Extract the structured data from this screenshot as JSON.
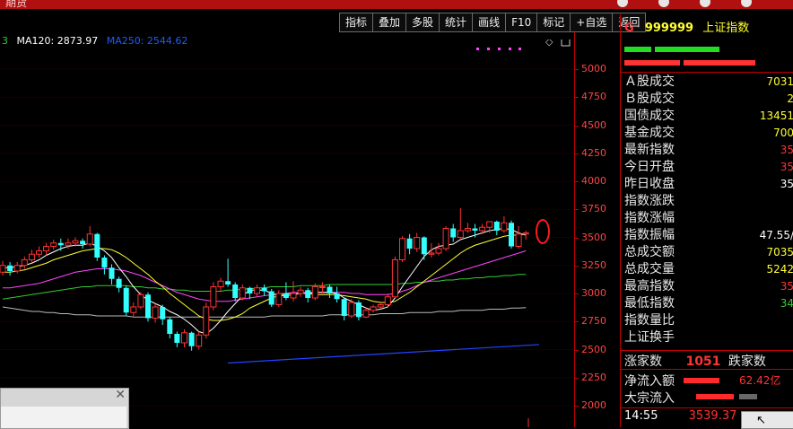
{
  "window": {
    "title": "期货"
  },
  "toolbar": {
    "buttons": [
      "指标",
      "叠加",
      "多股",
      "统计",
      "画线",
      "F10",
      "标记",
      "+自选",
      "返回"
    ]
  },
  "legend": {
    "prefix": "3",
    "ma120": "MA120: 2873.97",
    "ma250": "MA250: 2544.62",
    "ma120_color": "#ffffff",
    "ma250_color": "#1c5cff"
  },
  "axis": {
    "labels": [
      "5000",
      "4750",
      "4500",
      "4250",
      "4000",
      "3750",
      "3500",
      "3250",
      "3000",
      "2750",
      "2500",
      "2250",
      "2000"
    ]
  },
  "chart_data": {
    "type": "candlestick",
    "ylim": [
      2000,
      5000
    ],
    "colors": {
      "up": "#ff3333",
      "down": "#33ffff",
      "ma5": "#ffffff",
      "ma10": "#ffff33",
      "ma20": "#ff44ff",
      "ma60": "#33cc33",
      "ma120": "#bbbbbb",
      "ma250": "#2244ff"
    },
    "candles": [
      [
        3190,
        3250,
        3160,
        3290
      ],
      [
        3250,
        3200,
        3160,
        3280
      ],
      [
        3200,
        3250,
        3180,
        3280
      ],
      [
        3250,
        3300,
        3220,
        3330
      ],
      [
        3300,
        3350,
        3270,
        3390
      ],
      [
        3350,
        3380,
        3320,
        3420
      ],
      [
        3380,
        3420,
        3340,
        3450
      ],
      [
        3420,
        3450,
        3390,
        3480
      ],
      [
        3450,
        3430,
        3380,
        3490
      ],
      [
        3430,
        3450,
        3400,
        3490
      ],
      [
        3450,
        3470,
        3420,
        3500
      ],
      [
        3470,
        3440,
        3400,
        3490
      ],
      [
        3440,
        3530,
        3420,
        3600
      ],
      [
        3530,
        3320,
        3290,
        3540
      ],
      [
        3320,
        3230,
        3170,
        3340
      ],
      [
        3230,
        3130,
        3080,
        3260
      ],
      [
        3130,
        3050,
        3010,
        3150
      ],
      [
        3050,
        2830,
        2800,
        3070
      ],
      [
        2830,
        2880,
        2790,
        2920
      ],
      [
        2880,
        2990,
        2860,
        3010
      ],
      [
        2990,
        2780,
        2750,
        3010
      ],
      [
        2780,
        2880,
        2740,
        2910
      ],
      [
        2880,
        2770,
        2720,
        2900
      ],
      [
        2770,
        2640,
        2600,
        2790
      ],
      [
        2640,
        2560,
        2520,
        2660
      ],
      [
        2560,
        2650,
        2520,
        2680
      ],
      [
        2650,
        2530,
        2490,
        2660
      ],
      [
        2530,
        2630,
        2500,
        2660
      ],
      [
        2630,
        2880,
        2600,
        2920
      ],
      [
        2880,
        3060,
        2850,
        3100
      ],
      [
        3060,
        3110,
        3020,
        3140
      ],
      [
        3110,
        3080,
        3060,
        3310
      ],
      [
        3080,
        2960,
        2930,
        3100
      ],
      [
        2960,
        3050,
        2940,
        3080
      ],
      [
        3050,
        3000,
        2950,
        3060
      ],
      [
        3000,
        3050,
        2970,
        3080
      ],
      [
        3050,
        3020,
        2980,
        3080
      ],
      [
        3020,
        2900,
        2880,
        3040
      ],
      [
        2900,
        3000,
        2880,
        3030
      ],
      [
        3000,
        2960,
        2940,
        3100
      ],
      [
        2960,
        3000,
        2930,
        3110
      ],
      [
        3000,
        3030,
        2970,
        3060
      ],
      [
        3030,
        2960,
        2920,
        3050
      ],
      [
        2960,
        3060,
        2940,
        3090
      ],
      [
        3060,
        3060,
        3000,
        3100
      ],
      [
        3060,
        3000,
        2960,
        3080
      ],
      [
        3000,
        2950,
        2920,
        3060
      ],
      [
        2950,
        2800,
        2760,
        2960
      ],
      [
        2800,
        2920,
        2780,
        2950
      ],
      [
        2920,
        2790,
        2760,
        2940
      ],
      [
        2790,
        2850,
        2780,
        2880
      ],
      [
        2850,
        2880,
        2830,
        2900
      ],
      [
        2880,
        2900,
        2860,
        2920
      ],
      [
        2900,
        2970,
        2880,
        3000
      ],
      [
        2970,
        3300,
        2960,
        3330
      ],
      [
        3300,
        3490,
        3280,
        3510
      ],
      [
        3490,
        3400,
        3350,
        3530
      ],
      [
        3400,
        3500,
        3370,
        3540
      ],
      [
        3500,
        3350,
        3300,
        3510
      ],
      [
        3350,
        3360,
        3320,
        3450
      ],
      [
        3360,
        3400,
        3340,
        3450
      ],
      [
        3400,
        3580,
        3380,
        3600
      ],
      [
        3580,
        3500,
        3460,
        3620
      ],
      [
        3500,
        3560,
        3480,
        3760
      ],
      [
        3560,
        3580,
        3540,
        3630
      ],
      [
        3580,
        3560,
        3500,
        3620
      ],
      [
        3560,
        3590,
        3530,
        3620
      ],
      [
        3590,
        3640,
        3540,
        3640
      ],
      [
        3640,
        3560,
        3520,
        3650
      ],
      [
        3560,
        3630,
        3540,
        3690
      ],
      [
        3630,
        3420,
        3400,
        3650
      ],
      [
        3420,
        3530,
        3400,
        3600
      ],
      [
        3530,
        3540,
        3480,
        3560
      ]
    ],
    "ma5": [
      3230,
      3230,
      3240,
      3250,
      3270,
      3300,
      3340,
      3370,
      3400,
      3420,
      3430,
      3430,
      3450,
      3420,
      3380,
      3320,
      3230,
      3150,
      3060,
      2990,
      2940,
      2910,
      2880,
      2840,
      2810,
      2770,
      2720,
      2660,
      2640,
      2690,
      2760,
      2840,
      2910,
      2980,
      3030,
      3030,
      3030,
      3000,
      2980,
      2980,
      2990,
      3000,
      3000,
      3010,
      3010,
      3010,
      3000,
      2960,
      2930,
      2900,
      2870,
      2850,
      2860,
      2880,
      2960,
      3060,
      3150,
      3240,
      3330,
      3390,
      3420,
      3430,
      3440,
      3480,
      3500,
      3520,
      3540,
      3560,
      3570,
      3580,
      3570,
      3540,
      3520
    ],
    "ma10": [
      3190,
      3190,
      3200,
      3210,
      3230,
      3250,
      3270,
      3300,
      3320,
      3340,
      3360,
      3380,
      3390,
      3400,
      3400,
      3390,
      3360,
      3320,
      3270,
      3220,
      3170,
      3110,
      3060,
      3000,
      2950,
      2900,
      2850,
      2800,
      2770,
      2760,
      2760,
      2770,
      2790,
      2820,
      2870,
      2900,
      2930,
      2960,
      2980,
      3000,
      3000,
      3000,
      3000,
      2990,
      2990,
      2990,
      2990,
      2980,
      2970,
      2960,
      2950,
      2930,
      2920,
      2920,
      2930,
      2970,
      3010,
      3060,
      3110,
      3160,
      3210,
      3260,
      3310,
      3360,
      3400,
      3430,
      3450,
      3470,
      3490,
      3510,
      3520,
      3520,
      3530
    ],
    "ma20": [
      3050,
      3050,
      3060,
      3070,
      3080,
      3090,
      3110,
      3130,
      3150,
      3170,
      3190,
      3200,
      3210,
      3220,
      3220,
      3220,
      3210,
      3200,
      3180,
      3160,
      3130,
      3100,
      3070,
      3040,
      3010,
      2990,
      2970,
      2950,
      2940,
      2930,
      2930,
      2930,
      2940,
      2950,
      2960,
      2970,
      2980,
      2990,
      3000,
      3000,
      3010,
      3010,
      3010,
      3010,
      3010,
      3010,
      3010,
      3010,
      3000,
      3000,
      2990,
      2990,
      2990,
      2990,
      3000,
      3020,
      3040,
      3070,
      3100,
      3120,
      3140,
      3160,
      3180,
      3200,
      3220,
      3240,
      3260,
      3280,
      3300,
      3320,
      3340,
      3360,
      3380
    ],
    "ma60": [
      2950,
      2960,
      2970,
      2980,
      2990,
      3000,
      3010,
      3020,
      3030,
      3040,
      3050,
      3060,
      3060,
      3070,
      3070,
      3070,
      3070,
      3070,
      3060,
      3060,
      3050,
      3050,
      3040,
      3040,
      3030,
      3030,
      3020,
      3020,
      3020,
      3020,
      3020,
      3030,
      3030,
      3040,
      3040,
      3050,
      3050,
      3060,
      3060,
      3060,
      3060,
      3070,
      3070,
      3070,
      3070,
      3080,
      3080,
      3080,
      3080,
      3080,
      3080,
      3080,
      3080,
      3080,
      3080,
      3090,
      3090,
      3100,
      3100,
      3110,
      3110,
      3120,
      3120,
      3130,
      3130,
      3140,
      3140,
      3150,
      3150,
      3160,
      3160,
      3170,
      3170
    ],
    "ma120": [
      2880,
      2870,
      2860,
      2850,
      2840,
      2840,
      2830,
      2830,
      2820,
      2820,
      2810,
      2810,
      2810,
      2800,
      2800,
      2800,
      2800,
      2800,
      2790,
      2790,
      2790,
      2790,
      2790,
      2790,
      2790,
      2790,
      2790,
      2790,
      2790,
      2790,
      2790,
      2790,
      2790,
      2790,
      2790,
      2790,
      2790,
      2800,
      2800,
      2800,
      2800,
      2800,
      2800,
      2800,
      2800,
      2810,
      2810,
      2810,
      2810,
      2810,
      2810,
      2810,
      2820,
      2820,
      2820,
      2820,
      2830,
      2830,
      2830,
      2830,
      2840,
      2840,
      2840,
      2850,
      2850,
      2850,
      2850,
      2860,
      2860,
      2860,
      2870,
      2870,
      2874
    ],
    "ma250_start": 2380,
    "ma250_end": 2544.62
  },
  "panel": {
    "market": "G",
    "code": "999999",
    "name": "上证指数",
    "rows": [
      {
        "label": "Ａ股成交",
        "value": "7031",
        "color": "#ffff33"
      },
      {
        "label": "Ｂ股成交",
        "value": "2",
        "color": "#ffff33"
      },
      {
        "label": "国债成交",
        "value": "13451",
        "color": "#ffff33"
      },
      {
        "label": "基金成交",
        "value": "700",
        "color": "#ffff33"
      },
      {
        "label": "最新指数",
        "value": "35",
        "color": "#ff3333"
      },
      {
        "label": "今日开盘",
        "value": "35",
        "color": "#ff3333"
      },
      {
        "label": "昨日收盘",
        "value": "35",
        "color": "#ffffff"
      },
      {
        "label": "指数涨跌",
        "value": "",
        "color": "#ffffff"
      },
      {
        "label": "指数涨幅",
        "value": "",
        "color": "#ffffff"
      },
      {
        "label": "指数振幅",
        "value": "47.55/",
        "color": "#ffffff"
      },
      {
        "label": "总成交额",
        "value": "7035",
        "color": "#ffff33"
      },
      {
        "label": "总成交量",
        "value": "5242",
        "color": "#ffff33"
      },
      {
        "label": "最高指数",
        "value": "35",
        "color": "#ff3333"
      },
      {
        "label": "最低指数",
        "value": "34",
        "color": "#33cc33"
      },
      {
        "label": "指数量比",
        "value": "",
        "color": "#ffffff"
      },
      {
        "label": "上证换手",
        "value": "",
        "color": "#ffffff"
      }
    ],
    "rise_label": "涨家数",
    "rise_count": "1051",
    "fall_label": "跌家数",
    "net_inflow_label": "净流入额",
    "net_inflow_value": "62.42亿",
    "block_flow_label": "大宗流入",
    "time": "14:55",
    "price": "3539.37"
  }
}
